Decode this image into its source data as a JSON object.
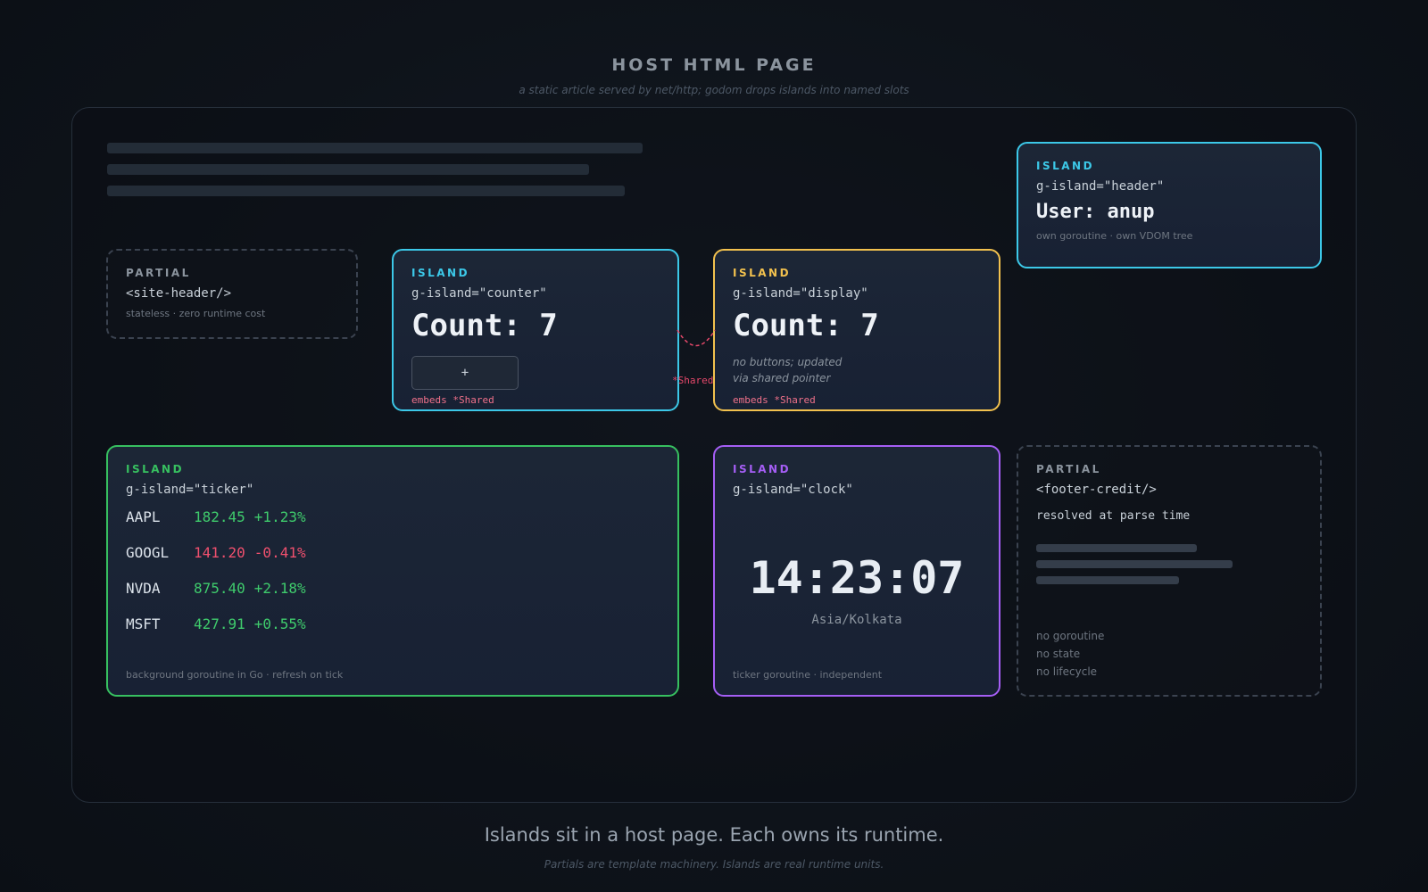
{
  "page": {
    "title": "HOST HTML PAGE",
    "subtitle": "a static article served by net/http; godom drops islands into named slots"
  },
  "colors": {
    "cyan": "#3cc8e8",
    "yellow": "#f2c14e",
    "green": "#37c060",
    "purple": "#a55ef5",
    "shared": "#e5486a"
  },
  "header_island": {
    "kind": "ISLAND",
    "attr": "g-island=\"header\"",
    "value": "User: anup",
    "note": "own goroutine · own VDOM tree"
  },
  "site_header_partial": {
    "kind": "PARTIAL",
    "tag": "<site-header/>",
    "note": "stateless · zero runtime cost"
  },
  "counter_island": {
    "kind": "ISLAND",
    "attr": "g-island=\"counter\"",
    "value": "Count: 7",
    "button_label": "+",
    "embeds": "embeds *Shared"
  },
  "display_island": {
    "kind": "ISLAND",
    "attr": "g-island=\"display\"",
    "value": "Count: 7",
    "note_line1": "no buttons; updated",
    "note_line2": "via shared pointer",
    "embeds": "embeds *Shared"
  },
  "shared_link": {
    "label": "*Shared"
  },
  "ticker_island": {
    "kind": "ISLAND",
    "attr": "g-island=\"ticker\"",
    "rows": [
      {
        "symbol": "AAPL",
        "price": "182.45",
        "change": "+1.23%",
        "trend": "up"
      },
      {
        "symbol": "GOOGL",
        "price": "141.20",
        "change": "-0.41%",
        "trend": "down"
      },
      {
        "symbol": "NVDA",
        "price": "875.40",
        "change": "+2.18%",
        "trend": "up"
      },
      {
        "symbol": "MSFT",
        "price": "427.91",
        "change": "+0.55%",
        "trend": "up"
      }
    ],
    "note": "background goroutine in Go · refresh on tick"
  },
  "clock_island": {
    "kind": "ISLAND",
    "attr": "g-island=\"clock\"",
    "time": "14:23:07",
    "timezone": "Asia/Kolkata",
    "note": "ticker goroutine · independent"
  },
  "footer_credit_partial": {
    "kind": "PARTIAL",
    "tag": "<footer-credit/>",
    "resolved": "resolved at parse time",
    "notes": [
      "no goroutine",
      "no state",
      "no lifecycle"
    ]
  },
  "footer": {
    "title": "Islands sit in a host page. Each owns its runtime.",
    "subtitle": "Partials are template machinery. Islands are real runtime units."
  }
}
